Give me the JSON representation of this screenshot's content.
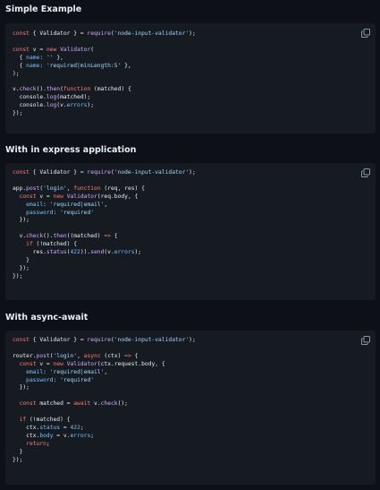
{
  "sections": [
    {
      "title": "Simple Example",
      "lines": [
        [
          [
            "k",
            "const"
          ],
          [
            "p",
            " { Validator } = "
          ],
          [
            "f",
            "require"
          ],
          [
            "p",
            "("
          ],
          [
            "s",
            "'node-input-validator'"
          ],
          [
            "p",
            ");"
          ]
        ],
        [],
        [
          [
            "k",
            "const"
          ],
          [
            "p",
            " v = "
          ],
          [
            "k",
            "new"
          ],
          [
            "p",
            " "
          ],
          [
            "f",
            "Validator"
          ],
          [
            "p",
            "("
          ]
        ],
        [
          [
            "p",
            "  { "
          ],
          [
            "n",
            "name"
          ],
          [
            "p",
            ": "
          ],
          [
            "s",
            "''"
          ],
          [
            "p",
            " },"
          ]
        ],
        [
          [
            "p",
            "  { "
          ],
          [
            "n",
            "name"
          ],
          [
            "p",
            ": "
          ],
          [
            "s",
            "'required|minLength:5'"
          ],
          [
            "p",
            " },"
          ]
        ],
        [
          [
            "p",
            ");"
          ]
        ],
        [],
        [
          [
            "p",
            "v."
          ],
          [
            "f",
            "check"
          ],
          [
            "p",
            "()."
          ],
          [
            "f",
            "then"
          ],
          [
            "p",
            "("
          ],
          [
            "k",
            "function"
          ],
          [
            "p",
            " (matched) {"
          ]
        ],
        [
          [
            "p",
            "  console."
          ],
          [
            "f",
            "log"
          ],
          [
            "p",
            "(matched);"
          ]
        ],
        [
          [
            "p",
            "  console."
          ],
          [
            "f",
            "log"
          ],
          [
            "p",
            "(v."
          ],
          [
            "n",
            "errors"
          ],
          [
            "p",
            ");"
          ]
        ],
        [
          [
            "p",
            "});"
          ]
        ]
      ]
    },
    {
      "title": "With in express application",
      "lines": [
        [
          [
            "k",
            "const"
          ],
          [
            "p",
            " { Validator } = "
          ],
          [
            "f",
            "require"
          ],
          [
            "p",
            "("
          ],
          [
            "s",
            "'node-input-validator'"
          ],
          [
            "p",
            ");"
          ]
        ],
        [],
        [
          [
            "p",
            "app."
          ],
          [
            "f",
            "post"
          ],
          [
            "p",
            "("
          ],
          [
            "s",
            "'login'"
          ],
          [
            "p",
            ", "
          ],
          [
            "k",
            "function"
          ],
          [
            "p",
            " (req, res) {"
          ]
        ],
        [
          [
            "p",
            "  "
          ],
          [
            "k",
            "const"
          ],
          [
            "p",
            " v = "
          ],
          [
            "k",
            "new"
          ],
          [
            "p",
            " "
          ],
          [
            "f",
            "Validator"
          ],
          [
            "p",
            "(req.body, {"
          ]
        ],
        [
          [
            "p",
            "    "
          ],
          [
            "n",
            "email"
          ],
          [
            "p",
            ": "
          ],
          [
            "s",
            "'required|email'"
          ],
          [
            "p",
            ","
          ]
        ],
        [
          [
            "p",
            "    "
          ],
          [
            "n",
            "password"
          ],
          [
            "p",
            ": "
          ],
          [
            "s",
            "'required'"
          ]
        ],
        [
          [
            "p",
            "  });"
          ]
        ],
        [],
        [
          [
            "p",
            "  v."
          ],
          [
            "f",
            "check"
          ],
          [
            "p",
            "()."
          ],
          [
            "f",
            "then"
          ],
          [
            "p",
            "((matched) "
          ],
          [
            "k",
            "=>"
          ],
          [
            "p",
            " {"
          ]
        ],
        [
          [
            "p",
            "    "
          ],
          [
            "k",
            "if"
          ],
          [
            "p",
            " (!matched) {"
          ]
        ],
        [
          [
            "p",
            "      res."
          ],
          [
            "f",
            "status"
          ],
          [
            "p",
            "("
          ],
          [
            "n",
            "422"
          ],
          [
            "p",
            "))."
          ],
          [
            "f",
            "send"
          ],
          [
            "p",
            "(v."
          ],
          [
            "n",
            "errors"
          ],
          [
            "p",
            ");"
          ]
        ],
        [
          [
            "p",
            "    }"
          ]
        ],
        [
          [
            "p",
            "  });"
          ]
        ],
        [
          [
            "p",
            "});"
          ]
        ]
      ]
    },
    {
      "title": "With async-await",
      "lines": [
        [
          [
            "k",
            "const"
          ],
          [
            "p",
            " { Validator } = "
          ],
          [
            "f",
            "require"
          ],
          [
            "p",
            "("
          ],
          [
            "s",
            "'node-input-validator'"
          ],
          [
            "p",
            ");"
          ]
        ],
        [],
        [
          [
            "p",
            "router."
          ],
          [
            "f",
            "post"
          ],
          [
            "p",
            "("
          ],
          [
            "s",
            "'login'"
          ],
          [
            "p",
            ", "
          ],
          [
            "k",
            "async"
          ],
          [
            "p",
            " (ctx) "
          ],
          [
            "k",
            "=>"
          ],
          [
            "p",
            " {"
          ]
        ],
        [
          [
            "p",
            "  "
          ],
          [
            "k",
            "const"
          ],
          [
            "p",
            " v = "
          ],
          [
            "k",
            "new"
          ],
          [
            "p",
            " "
          ],
          [
            "f",
            "Validator"
          ],
          [
            "p",
            "(ctx.request.body, {"
          ]
        ],
        [
          [
            "p",
            "    "
          ],
          [
            "n",
            "email"
          ],
          [
            "p",
            ": "
          ],
          [
            "s",
            "'required|email'"
          ],
          [
            "p",
            ","
          ]
        ],
        [
          [
            "p",
            "    "
          ],
          [
            "n",
            "password"
          ],
          [
            "p",
            ": "
          ],
          [
            "s",
            "'required'"
          ]
        ],
        [
          [
            "p",
            "  });"
          ]
        ],
        [],
        [
          [
            "p",
            "  "
          ],
          [
            "k",
            "const"
          ],
          [
            "p",
            " matched = "
          ],
          [
            "k",
            "await"
          ],
          [
            "p",
            " v."
          ],
          [
            "f",
            "check"
          ],
          [
            "p",
            "();"
          ]
        ],
        [],
        [
          [
            "p",
            "  "
          ],
          [
            "k",
            "if"
          ],
          [
            "p",
            " (!matched) {"
          ]
        ],
        [
          [
            "p",
            "    ctx."
          ],
          [
            "n",
            "status"
          ],
          [
            "p",
            " = "
          ],
          [
            "n",
            "422"
          ],
          [
            "p",
            ";"
          ]
        ],
        [
          [
            "p",
            "    ctx."
          ],
          [
            "n",
            "body"
          ],
          [
            "p",
            " = v."
          ],
          [
            "n",
            "errors"
          ],
          [
            "p",
            ";"
          ]
        ],
        [
          [
            "p",
            "    "
          ],
          [
            "k",
            "return"
          ],
          [
            "p",
            ";"
          ]
        ],
        [
          [
            "p",
            "  }"
          ]
        ],
        [
          [
            "p",
            "});"
          ]
        ]
      ]
    }
  ],
  "copy_icon": "copy-icon",
  "colors": {
    "page_bg": "#0d1117",
    "code_bg": "#161b22",
    "keyword": "#ff7b72",
    "string": "#a5d6ff",
    "function": "#d2a8ff",
    "constant": "#79c0ff",
    "text": "#e6edf3"
  }
}
